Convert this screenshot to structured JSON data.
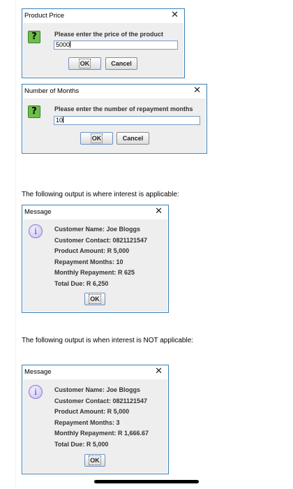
{
  "price_dialog": {
    "title": "Product Price",
    "close": "✕",
    "icon": "question-icon",
    "prompt": "Please enter the price of the product",
    "value": "5000",
    "ok": "OK",
    "cancel": "Cancel"
  },
  "months_dialog": {
    "title": "Number of Months",
    "close": "✕",
    "icon": "question-icon",
    "prompt": "Please enter the number of repayment months",
    "value": "10",
    "ok": "OK",
    "cancel": "Cancel"
  },
  "text_interest": "The following output is where interest is applicable:",
  "message1": {
    "title": "Message",
    "close": "✕",
    "icon": "info-icon",
    "lines": [
      "Customer Name: Joe Bloggs",
      "Customer Contact: 0821121547",
      "Product Amount: R 5,000",
      "Repayment Months: 10",
      "Monthly Repayment: R 625",
      "Total Due: R 6,250"
    ],
    "ok": "OK"
  },
  "text_no_interest": "The following output is when interest is NOT applicable:",
  "message2": {
    "title": "Message",
    "close": "✕",
    "icon": "info-icon",
    "lines": [
      "Customer Name: Joe Bloggs",
      "Customer Contact: 0821121547",
      "Product Amount: R 5,000",
      "Repayment Months: 3",
      "Monthly Repayment: R 1,666.67",
      "Total Due: R 5,000"
    ],
    "ok": "OK"
  }
}
